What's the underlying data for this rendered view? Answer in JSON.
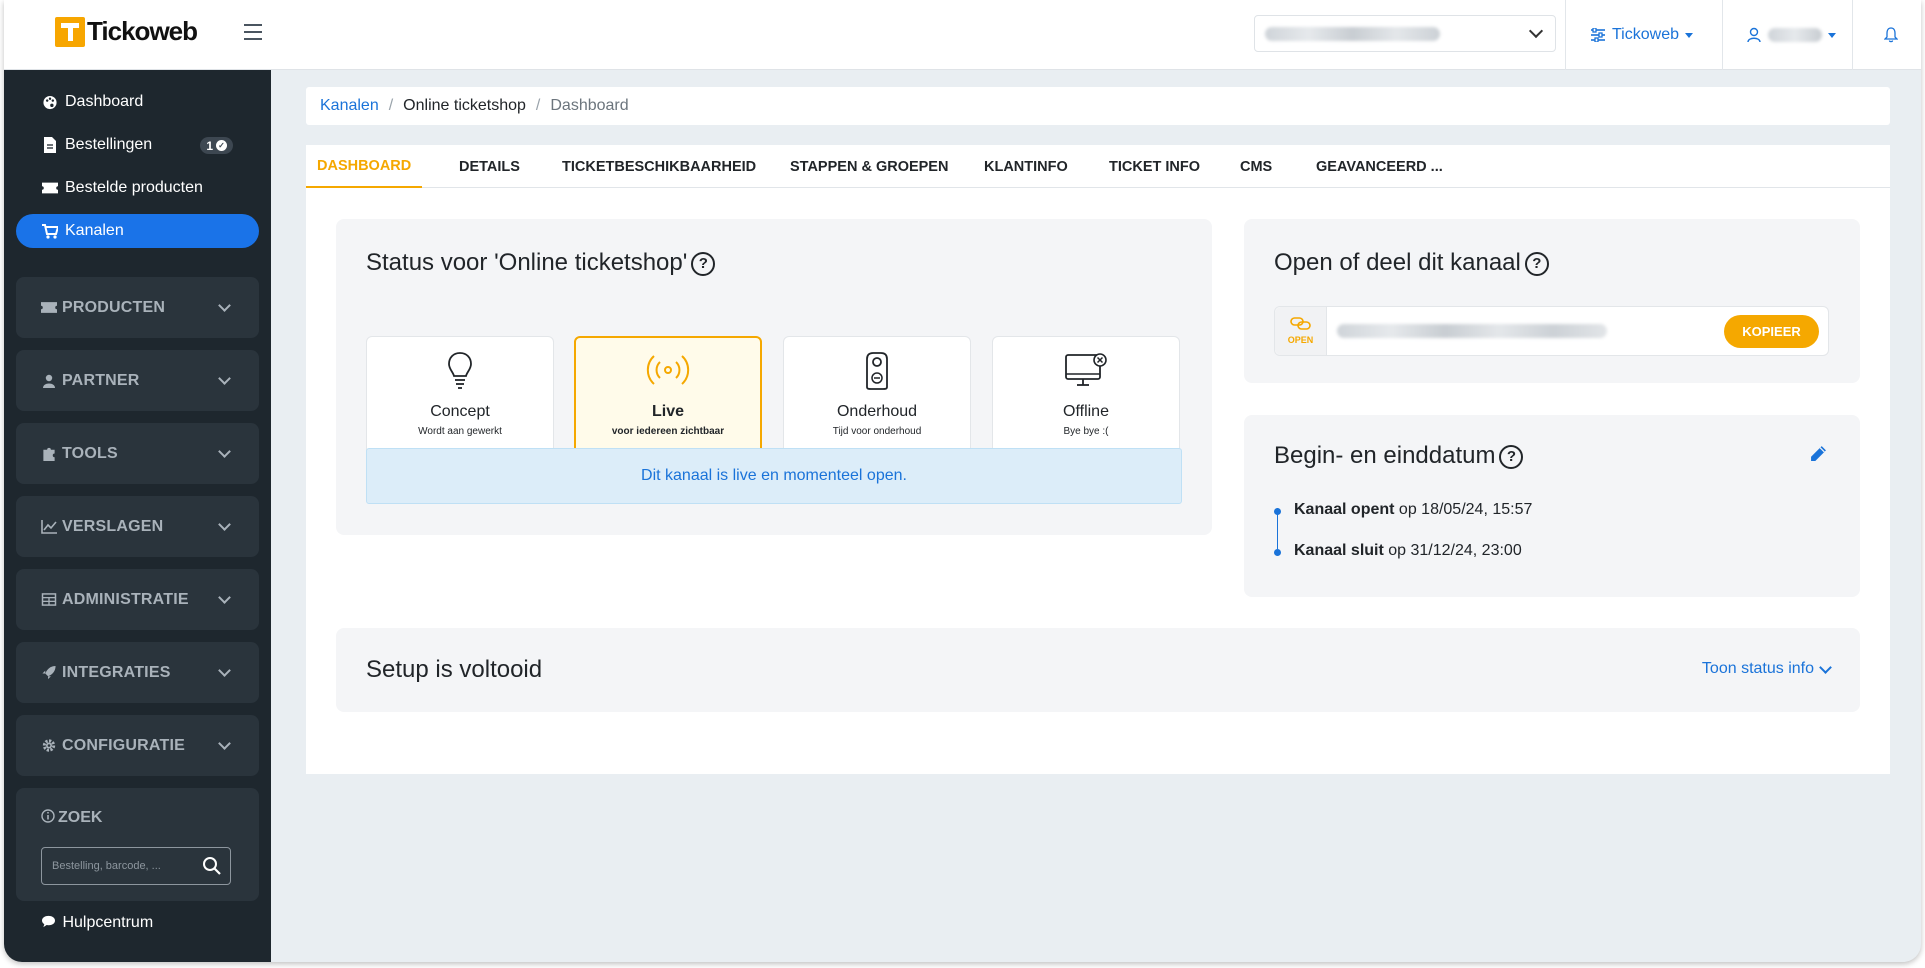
{
  "app": {
    "name": "Tickoweb"
  },
  "topbar": {
    "org_menu_label": "Tickoweb",
    "colors": {
      "accent": "#1a73d9",
      "brand": "#f5a800"
    }
  },
  "sidebar": {
    "items": [
      {
        "label": "Dashboard",
        "icon": "palette-icon"
      },
      {
        "label": "Bestellingen",
        "icon": "document-icon",
        "badge": "1"
      },
      {
        "label": "Bestelde producten",
        "icon": "ticket-icon"
      },
      {
        "label": "Kanalen",
        "icon": "cart-icon",
        "active": true
      }
    ],
    "groups": [
      {
        "label": "PRODUCTEN",
        "icon": "ticket-icon"
      },
      {
        "label": "PARTNER",
        "icon": "user-tie-icon"
      },
      {
        "label": "TOOLS",
        "icon": "puzzle-icon"
      },
      {
        "label": "VERSLAGEN",
        "icon": "chart-line-icon"
      },
      {
        "label": "ADMINISTRATIE",
        "icon": "table-icon"
      },
      {
        "label": "INTEGRATIES",
        "icon": "rocket-icon"
      },
      {
        "label": "CONFIGURATIE",
        "icon": "gear-icon"
      }
    ],
    "search": {
      "label": "ZOEK",
      "placeholder": "Bestelling, barcode, ..."
    },
    "help": "Hulpcentrum"
  },
  "breadcrumb": {
    "link": "Kanalen",
    "current": "Online ticketshop",
    "page": "Dashboard"
  },
  "tabs": [
    {
      "label": "DASHBOARD",
      "active": true
    },
    {
      "label": "DETAILS"
    },
    {
      "label": "TICKETBESCHIKBAARHEID"
    },
    {
      "label": "STAPPEN & GROEPEN"
    },
    {
      "label": "KLANTINFO"
    },
    {
      "label": "TICKET INFO"
    },
    {
      "label": "CMS"
    },
    {
      "label": "GEAVANCEERD ..."
    }
  ],
  "status": {
    "title": "Status voor 'Online ticketshop'",
    "options": [
      {
        "title": "Concept",
        "subtitle": "Wordt aan gewerkt",
        "icon": "lightbulb-icon"
      },
      {
        "title": "Live",
        "subtitle": "voor iedereen zichtbaar",
        "icon": "broadcast-icon",
        "selected": true
      },
      {
        "title": "Onderhoud",
        "subtitle": "Tijd voor onderhoud",
        "icon": "door-hanger-icon"
      },
      {
        "title": "Offline",
        "subtitle": "Bye bye :(",
        "icon": "monitor-off-icon"
      }
    ],
    "message": "Dit kanaal is live en momenteel open."
  },
  "share": {
    "title": "Open of deel dit kanaal",
    "open_label": "OPEN",
    "copy_label": "KOPIEER"
  },
  "dates": {
    "title": "Begin- en einddatum",
    "open_label": "Kanaal opent",
    "open_value": "op 18/05/24, 15:57",
    "close_label": "Kanaal sluit",
    "close_value": "op 31/12/24, 23:00"
  },
  "setup": {
    "title": "Setup is voltooid",
    "toggle_label": "Toon status info"
  }
}
